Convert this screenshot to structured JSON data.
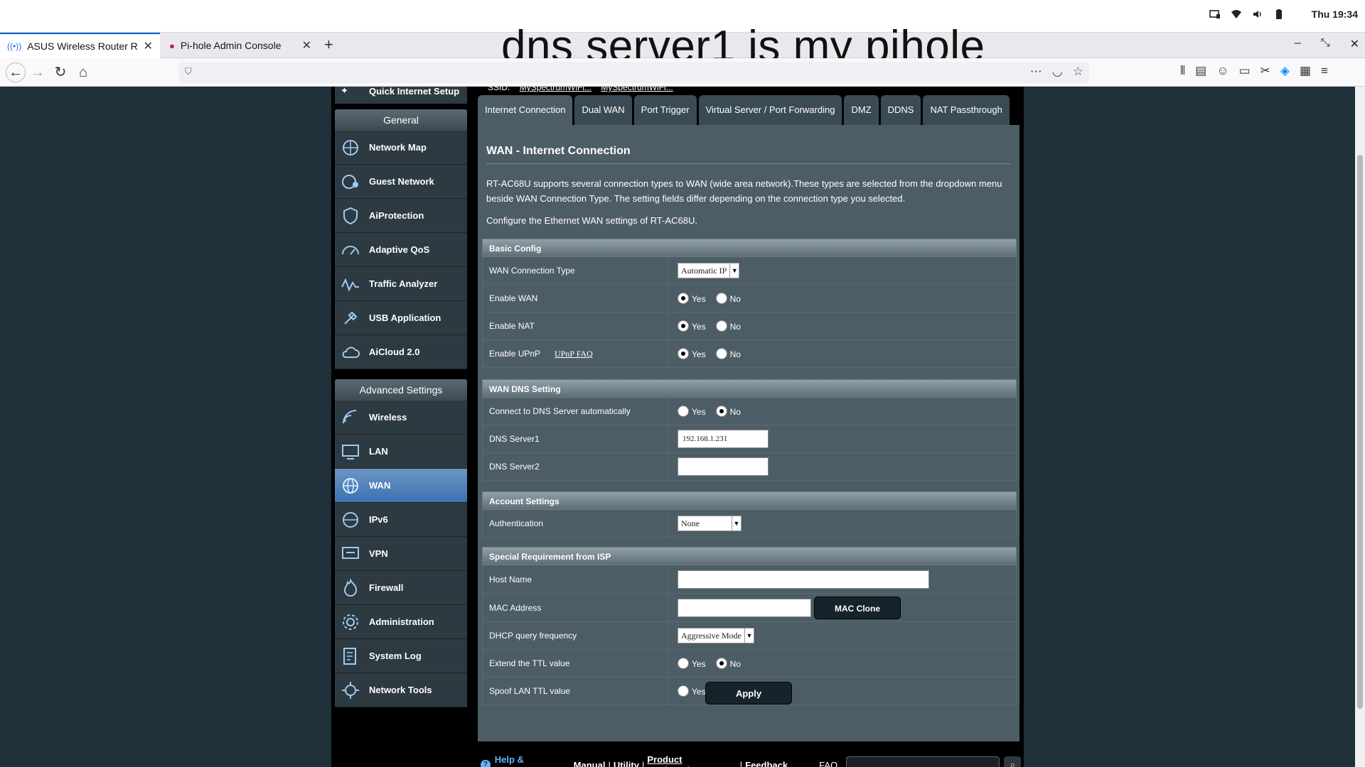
{
  "os_bar": {
    "clock": "Thu 19:34"
  },
  "browser": {
    "tabs": [
      {
        "label": "ASUS Wireless Router RT-"
      },
      {
        "label": "Pi-hole Admin Console"
      }
    ],
    "overlay_caption": "dns server1 is my pihole"
  },
  "sidebar": {
    "quick_setup": "Quick Internet Setup",
    "general_header": "General",
    "general_items": [
      {
        "label": "Network Map",
        "icon": "network-map-icon"
      },
      {
        "label": "Guest Network",
        "icon": "guest-network-icon"
      },
      {
        "label": "AiProtection",
        "icon": "aiprotection-icon"
      },
      {
        "label": "Adaptive QoS",
        "icon": "qos-icon"
      },
      {
        "label": "Traffic Analyzer",
        "icon": "traffic-icon"
      },
      {
        "label": "USB Application",
        "icon": "usb-icon"
      },
      {
        "label": "AiCloud 2.0",
        "icon": "cloud-icon"
      }
    ],
    "advanced_header": "Advanced Settings",
    "advanced_items": [
      {
        "label": "Wireless"
      },
      {
        "label": "LAN"
      },
      {
        "label": "WAN"
      },
      {
        "label": "IPv6"
      },
      {
        "label": "VPN"
      },
      {
        "label": "Firewall"
      },
      {
        "label": "Administration"
      },
      {
        "label": "System Log"
      },
      {
        "label": "Network Tools"
      }
    ]
  },
  "main": {
    "ssid_label": "SSID:",
    "ssid_values": [
      "MySpectrumWiFi...",
      "MySpectrumWiFi..."
    ],
    "tabs": [
      {
        "label": "Internet Connection"
      },
      {
        "label": "Dual WAN"
      },
      {
        "label": "Port Trigger"
      },
      {
        "label": "Virtual Server / Port Forwarding"
      },
      {
        "label": "DMZ"
      },
      {
        "label": "DDNS"
      },
      {
        "label": "NAT Passthrough"
      }
    ],
    "title": "WAN - Internet Connection",
    "description": "RT-AC68U supports several connection types to WAN (wide area network).These types are selected from the dropdown menu beside WAN Connection Type. The setting fields differ depending on the connection type you selected.",
    "configure_text": "Configure the Ethernet WAN settings of RT-AC68U.",
    "yes": "Yes",
    "no": "No",
    "basic": {
      "header": "Basic Config",
      "wan_type_label": "WAN Connection Type",
      "wan_type_value": "Automatic IP",
      "enable_wan": "Enable WAN",
      "enable_nat": "Enable NAT",
      "enable_upnp": "Enable UPnP",
      "upnp_faq": "UPnP FAQ"
    },
    "dns": {
      "header": "WAN DNS Setting",
      "auto_label": "Connect to DNS Server automatically",
      "server1_label": "DNS Server1",
      "server1_value": "192.168.1.231",
      "server2_label": "DNS Server2",
      "server2_value": ""
    },
    "account": {
      "header": "Account Settings",
      "auth_label": "Authentication",
      "auth_value": "None"
    },
    "isp": {
      "header": "Special Requirement from ISP",
      "host_label": "Host Name",
      "host_value": "",
      "mac_label": "MAC Address",
      "mac_value": "",
      "mac_clone": "MAC Clone",
      "dhcp_label": "DHCP query frequency",
      "dhcp_value": "Aggressive Mode",
      "ttl_label": "Extend the TTL value",
      "spoof_label": "Spoof LAN TTL value"
    },
    "apply": "Apply"
  },
  "footer": {
    "help": "Help & Support",
    "links": [
      "Manual",
      "Utility",
      "Product Registration",
      "Feedback"
    ],
    "faq": "FAQ"
  }
}
